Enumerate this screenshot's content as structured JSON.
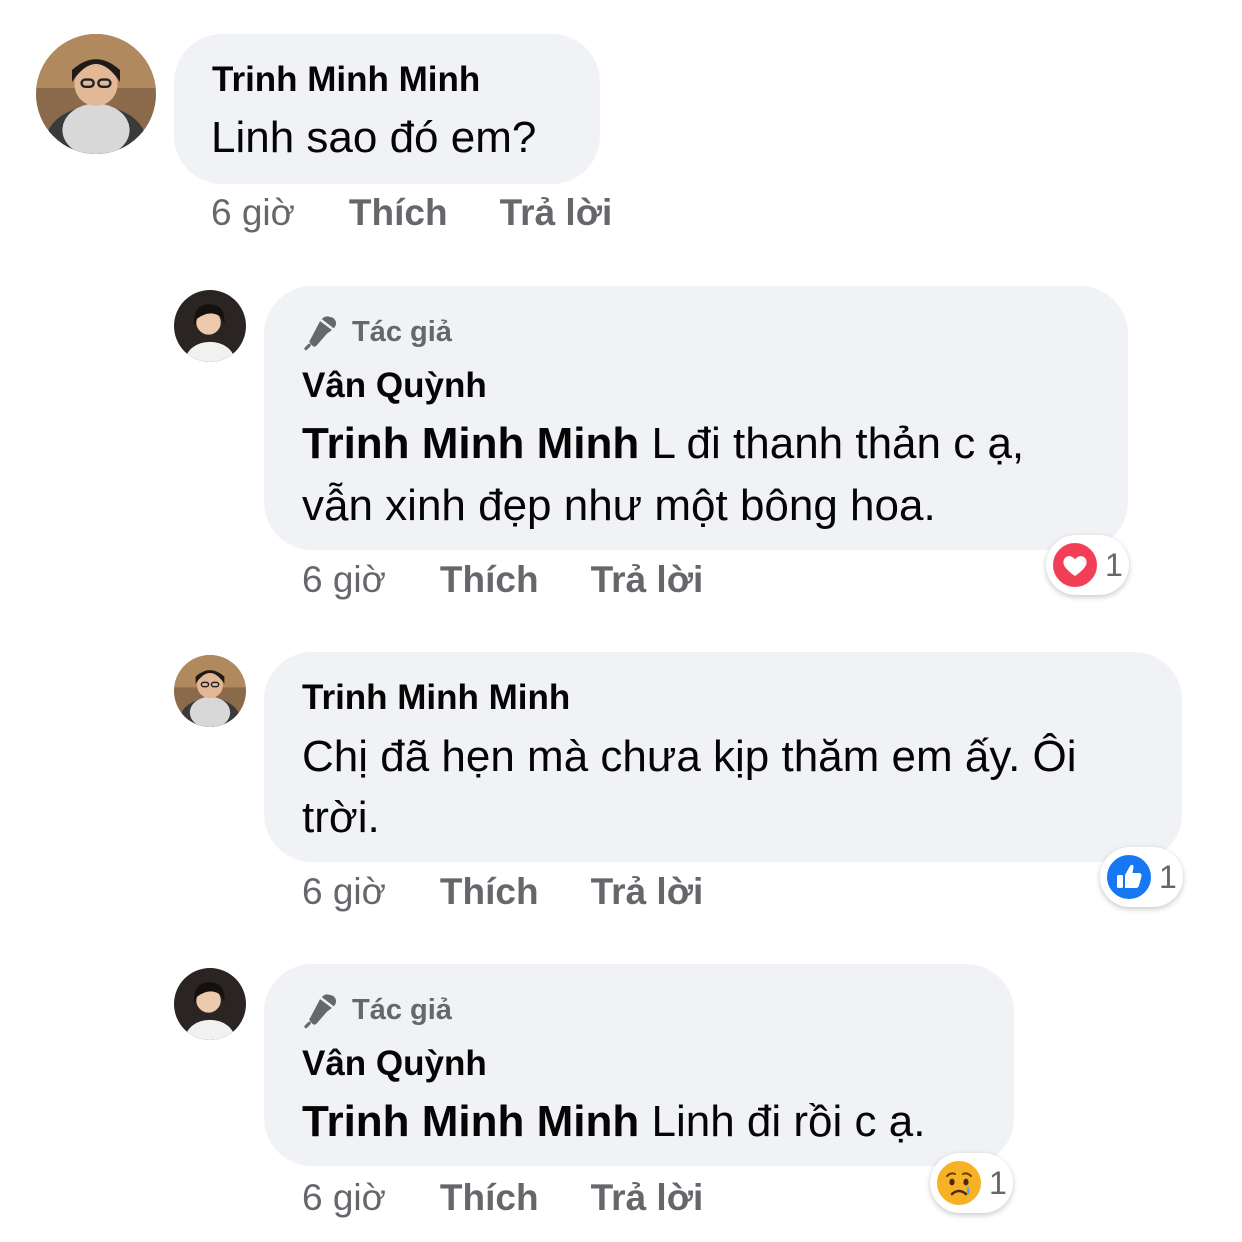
{
  "comments": [
    {
      "name": "Trinh Minh Minh",
      "text": "Linh sao đó em?",
      "time": "6 giờ",
      "like": "Thích",
      "reply": "Trả lời"
    },
    {
      "badge": "Tác giả",
      "name": "Vân Quỳnh",
      "tag": "Trinh Minh Minh",
      "line1": " L đi thanh thản c ạ,",
      "line2": "vẫn xinh đẹp như một bông hoa.",
      "time": "6 giờ",
      "like": "Thích",
      "reply": "Trả lời",
      "reaction": {
        "icon": "heart-reaction-icon",
        "count": "1",
        "color": "#f33e58"
      }
    },
    {
      "name": "Trinh Minh Minh",
      "line1": "Chị đã hẹn mà chưa kịp thăm em ấy. Ôi",
      "line2": "trời.",
      "time": "6 giờ",
      "like": "Thích",
      "reply": "Trả lời",
      "reaction": {
        "icon": "like-reaction-icon",
        "count": "1",
        "color": "#1877f2"
      }
    },
    {
      "badge": "Tác giả",
      "name": "Vân Quỳnh",
      "tag": "Trinh Minh Minh",
      "line1": " Linh đi rồi c ạ.",
      "time": "6 giờ",
      "like": "Thích",
      "reply": "Trả lời",
      "reaction": {
        "icon": "sad-reaction-icon",
        "count": "1",
        "color": "#f7b125"
      }
    }
  ]
}
